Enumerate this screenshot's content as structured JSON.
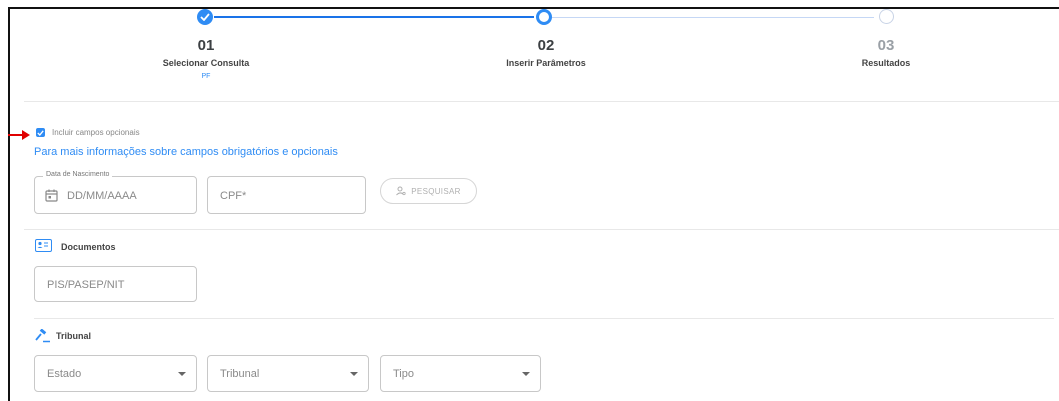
{
  "stepper": {
    "steps": [
      {
        "number": "01",
        "label": "Selecionar Consulta",
        "sub": "PF",
        "state": "completed"
      },
      {
        "number": "02",
        "label": "Inserir Parâmetros",
        "sub": "",
        "state": "active"
      },
      {
        "number": "03",
        "label": "Resultados",
        "sub": "",
        "state": "pending"
      }
    ]
  },
  "options": {
    "include_optional_label": "Incluir campos opcionais",
    "include_optional_checked": true,
    "info_link": "Para mais informações sobre campos obrigatórios e opcionais"
  },
  "search_fields": {
    "birth_date_legend": "Data de Nascimento",
    "birth_date_placeholder": "DD/MM/AAAA",
    "cpf_placeholder": "CPF*",
    "search_button": "PESQUISAR"
  },
  "documents": {
    "title": "Documentos",
    "pis_placeholder": "PIS/PASEP/NIT"
  },
  "tribunal": {
    "title": "Tribunal",
    "estado_placeholder": "Estado",
    "tribunal_placeholder": "Tribunal",
    "tipo_placeholder": "Tipo"
  },
  "colors": {
    "accent": "#2f8cf4",
    "arrow": "#e00000"
  }
}
